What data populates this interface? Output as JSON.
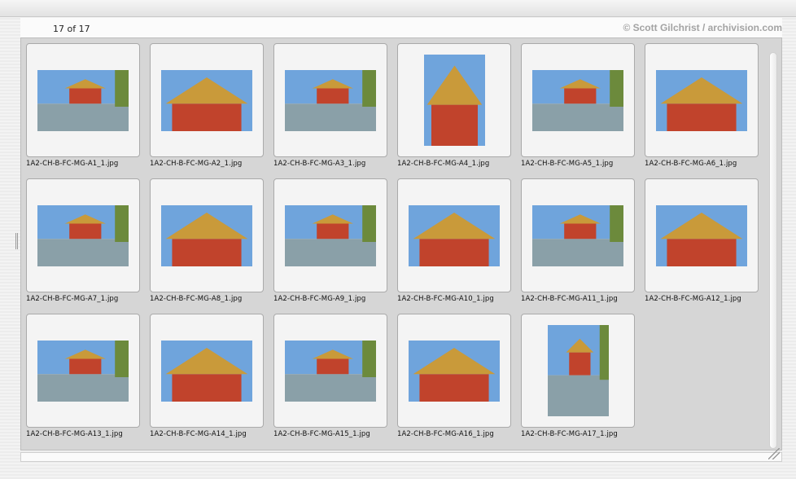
{
  "header": {
    "count": "17 of 17",
    "credit": "© Scott Gilchrist / archivision.com"
  },
  "thumbnails": [
    {
      "file": "1A2-CH-B-FC-MG-A1_1.jpg"
    },
    {
      "file": "1A2-CH-B-FC-MG-A2_1.jpg"
    },
    {
      "file": "1A2-CH-B-FC-MG-A3_1.jpg"
    },
    {
      "file": "1A2-CH-B-FC-MG-A4_1.jpg"
    },
    {
      "file": "1A2-CH-B-FC-MG-A5_1.jpg"
    },
    {
      "file": "1A2-CH-B-FC-MG-A6_1.jpg"
    },
    {
      "file": "1A2-CH-B-FC-MG-A7_1.jpg"
    },
    {
      "file": "1A2-CH-B-FC-MG-A8_1.jpg"
    },
    {
      "file": "1A2-CH-B-FC-MG-A9_1.jpg"
    },
    {
      "file": "1A2-CH-B-FC-MG-A10_1.jpg"
    },
    {
      "file": "1A2-CH-B-FC-MG-A11_1.jpg"
    },
    {
      "file": "1A2-CH-B-FC-MG-A12_1.jpg"
    },
    {
      "file": "1A2-CH-B-FC-MG-A13_1.jpg"
    },
    {
      "file": "1A2-CH-B-FC-MG-A14_1.jpg"
    },
    {
      "file": "1A2-CH-B-FC-MG-A15_1.jpg"
    },
    {
      "file": "1A2-CH-B-FC-MG-A16_1.jpg"
    },
    {
      "file": "1A2-CH-B-FC-MG-A17_1.jpg"
    }
  ],
  "colors": {
    "sky": "#6fa4dc",
    "wall": "#c1432c",
    "roof": "#c99a3a",
    "water": "#8aa0a8",
    "tree": "#6c8a3c"
  }
}
